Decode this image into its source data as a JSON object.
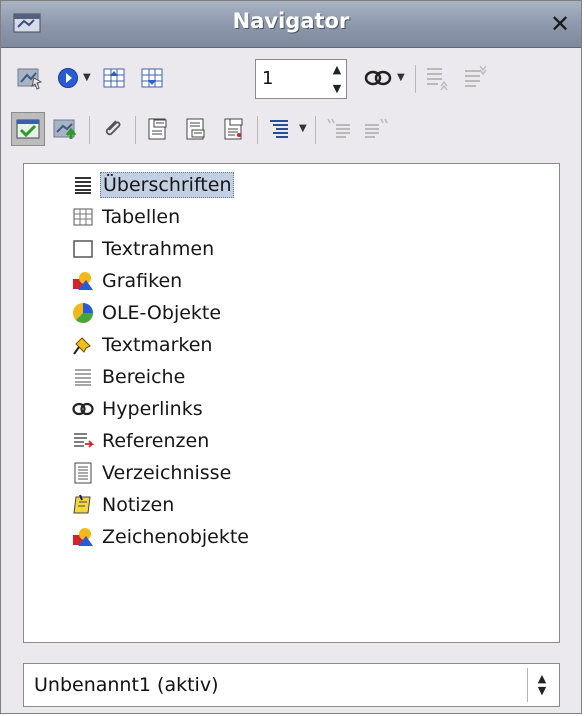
{
  "window": {
    "title": "Navigator",
    "close_glyph": "✕"
  },
  "toolbar1": {
    "spin_value": "1",
    "buttons": [
      "navigation-toggle-icon",
      "navigation-icon",
      "previous-object-icon",
      "next-object-icon",
      "dropdown",
      "page-spinner",
      "drag-mode-icon",
      "promote-level-icon",
      "demote-level-icon"
    ]
  },
  "toolbar2": {
    "buttons": [
      "content-view-icon",
      "list-box-toggle-icon",
      "reminder-icon",
      "header-icon",
      "footer-icon",
      "anchor-icon",
      "heading-levels-icon",
      "promote-chapter-icon",
      "demote-chapter-icon"
    ]
  },
  "tree": {
    "items": [
      {
        "label": "Überschriften",
        "icon": "headings-icon",
        "selected": true
      },
      {
        "label": "Tabellen",
        "icon": "table-icon"
      },
      {
        "label": "Textrahmen",
        "icon": "frame-icon"
      },
      {
        "label": "Grafiken",
        "icon": "graphics-icon"
      },
      {
        "label": "OLE-Objekte",
        "icon": "ole-object-icon"
      },
      {
        "label": "Textmarken",
        "icon": "bookmark-icon"
      },
      {
        "label": "Bereiche",
        "icon": "sections-icon"
      },
      {
        "label": "Hyperlinks",
        "icon": "hyperlink-icon"
      },
      {
        "label": "Referenzen",
        "icon": "references-icon"
      },
      {
        "label": "Verzeichnisse",
        "icon": "indexes-icon"
      },
      {
        "label": "Notizen",
        "icon": "notes-icon"
      },
      {
        "label": "Zeichenobjekte",
        "icon": "drawing-objects-icon"
      }
    ]
  },
  "document_select": {
    "value": "Unbenannt1 (aktiv)"
  },
  "colors": {
    "title_bar": "#8c97ab",
    "selection": "#c3d0e4",
    "accent_blue": "#2a5bd6"
  }
}
